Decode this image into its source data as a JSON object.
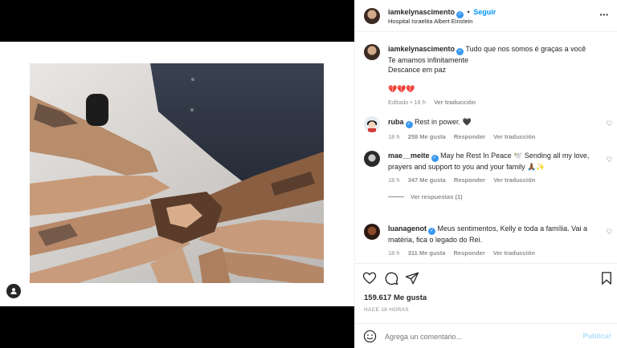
{
  "post": {
    "username": "iamkelynascimento",
    "follow_label": "Seguir",
    "location": "Hospital Israelita Albert Einstein",
    "caption_lines": [
      "Tudo que nos somos é graças a você",
      "Te amamos infinitamente",
      "Descance em paz"
    ],
    "caption_emoji": "💔💔💔",
    "caption_meta_edited": "Editado",
    "caption_meta_time": "18 h",
    "see_translation": "Ver traducción",
    "likes": "159.617 Me gusta",
    "posted_ago": "HACE 18 HORAS",
    "more_symbol": "•••",
    "dot": "•"
  },
  "comments": [
    {
      "user": "ruba",
      "text": "Rest in power. 🖤",
      "time": "18 h",
      "likes": "258 Me gusta",
      "reply": "Responder",
      "translate": "Ver traducción"
    },
    {
      "user": "mae__meite",
      "text": "May he Rest In Peace 🕊️ Sending all my love, prayers and support to you and your family 🙏🏾✨",
      "time": "18 h",
      "likes": "347 Me gusta",
      "reply": "Responder",
      "translate": "Ver traducción",
      "replies": "Ver respuestas (1)"
    },
    {
      "user": "luanagenot",
      "text": "Meus sentimentos, Kelly e toda a família. Vai a matéria, fica o legado do Rei.",
      "time": "18 h",
      "likes": "311 Me gusta",
      "reply": "Responder",
      "translate": "Ver traducción"
    }
  ],
  "composer": {
    "placeholder": "Agrega un comentario...",
    "publish_label": "Publicar"
  },
  "colors": {
    "accent": "#0095f6",
    "verified": "#3897f0",
    "muted": "#8e8e8e",
    "heart": "#ed4956"
  }
}
